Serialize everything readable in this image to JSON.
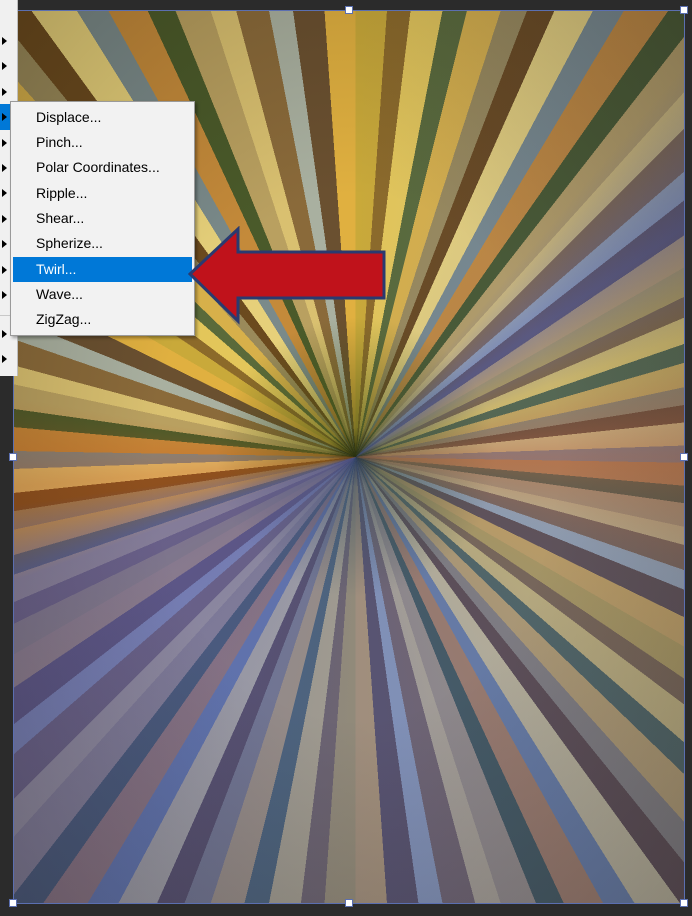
{
  "submenu": {
    "items": [
      {
        "label": "Displace..."
      },
      {
        "label": "Pinch..."
      },
      {
        "label": "Polar Coordinates..."
      },
      {
        "label": "Ripple..."
      },
      {
        "label": "Shear..."
      },
      {
        "label": "Spherize..."
      },
      {
        "label": "Twirl..."
      },
      {
        "label": "Wave..."
      },
      {
        "label": "ZigZag..."
      }
    ],
    "highlighted": "Twirl..."
  },
  "annotation": {
    "icon": "red-arrow-icon",
    "color": "#c0121b",
    "outline": "#2a3a70"
  },
  "colors": {
    "menu_highlight": "#0078d7",
    "selection": "#5b6fb0"
  }
}
